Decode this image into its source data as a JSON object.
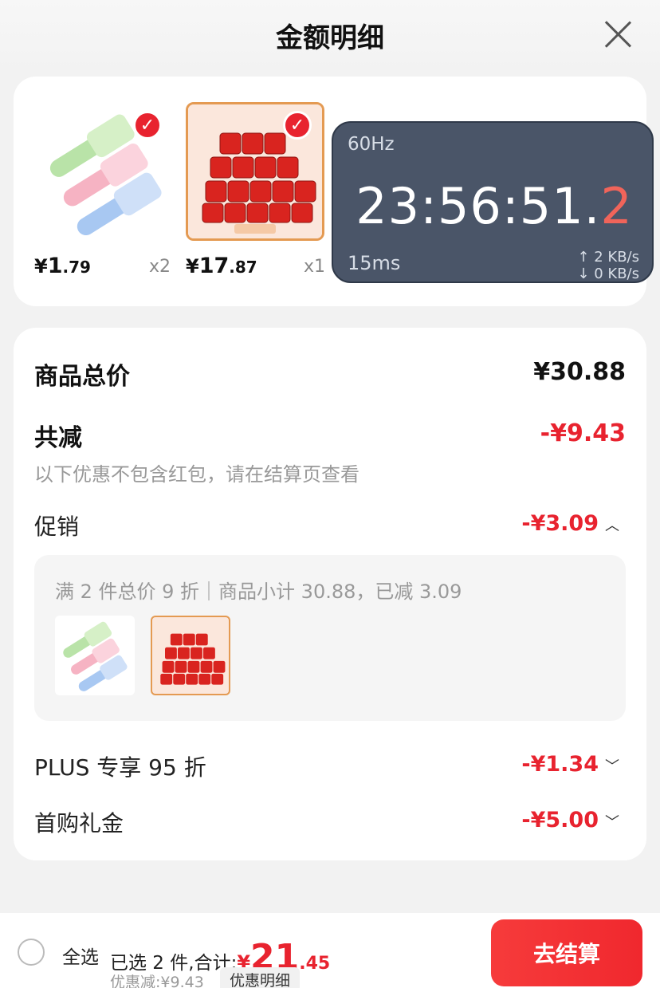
{
  "header": {
    "title": "金额明细"
  },
  "products": [
    {
      "price_int": "1",
      "price_dec": ".79",
      "qty": "x2"
    },
    {
      "price_int": "17",
      "price_dec": ".87",
      "qty": "x1"
    }
  ],
  "currency": "¥",
  "overlay": {
    "refresh": "60Hz",
    "time_main": "23:56:51.",
    "time_last": "2",
    "latency": "15ms",
    "upload": "↑ 2 KB/s",
    "download": "↓ 0 KB/s"
  },
  "detail": {
    "total_label": "商品总价",
    "total_value": "¥30.88",
    "reduce_label": "共减",
    "reduce_value": "-¥9.43",
    "note": "以下优惠不包含红包，请在结算页查看",
    "promo_label": "促销",
    "promo_value": "-¥3.09",
    "promo_text": "满 2 件总价 9 折｜商品小计 30.88，已减 3.09",
    "plus_label": "PLUS 专享 95 折",
    "plus_value": "-¥1.34",
    "first_label": "首购礼金",
    "first_value": "-¥5.00"
  },
  "bottom": {
    "select_all": "全选",
    "selected_text": "已选 2 件,合计:",
    "total_yen": "¥",
    "total_int": "21",
    "total_dec": ".45",
    "discount": "优惠减:¥9.43",
    "detail_button": "优惠明细",
    "checkout": "去结算"
  },
  "colors": {
    "accent": "#e8232f",
    "overlay_bg": "#4a5568"
  }
}
